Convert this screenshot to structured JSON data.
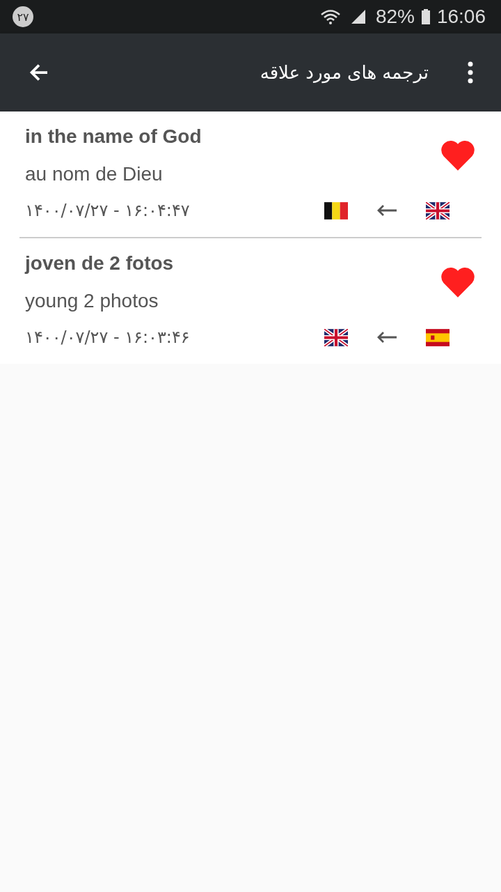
{
  "status_bar": {
    "notification_badge": "۲۷",
    "battery": "82%",
    "time": "16:06"
  },
  "app_bar": {
    "title": "ترجمه های مورد علاقه"
  },
  "items": [
    {
      "source": "in the name of God",
      "translation": "au nom de Dieu",
      "date": "۱۴۰۰/۰۷/۲۷ - ۱۶:۰۴:۴۷",
      "favorite": true,
      "flags": [
        {
          "kind": "be"
        },
        {
          "kind": "gb"
        }
      ]
    },
    {
      "source": "joven de 2 fotos",
      "translation": "young 2 photos",
      "date": "۱۴۰۰/۰۷/۲۷ - ۱۶:۰۳:۴۶",
      "favorite": true,
      "flags": [
        {
          "kind": "gb"
        },
        {
          "kind": "es"
        }
      ]
    }
  ]
}
